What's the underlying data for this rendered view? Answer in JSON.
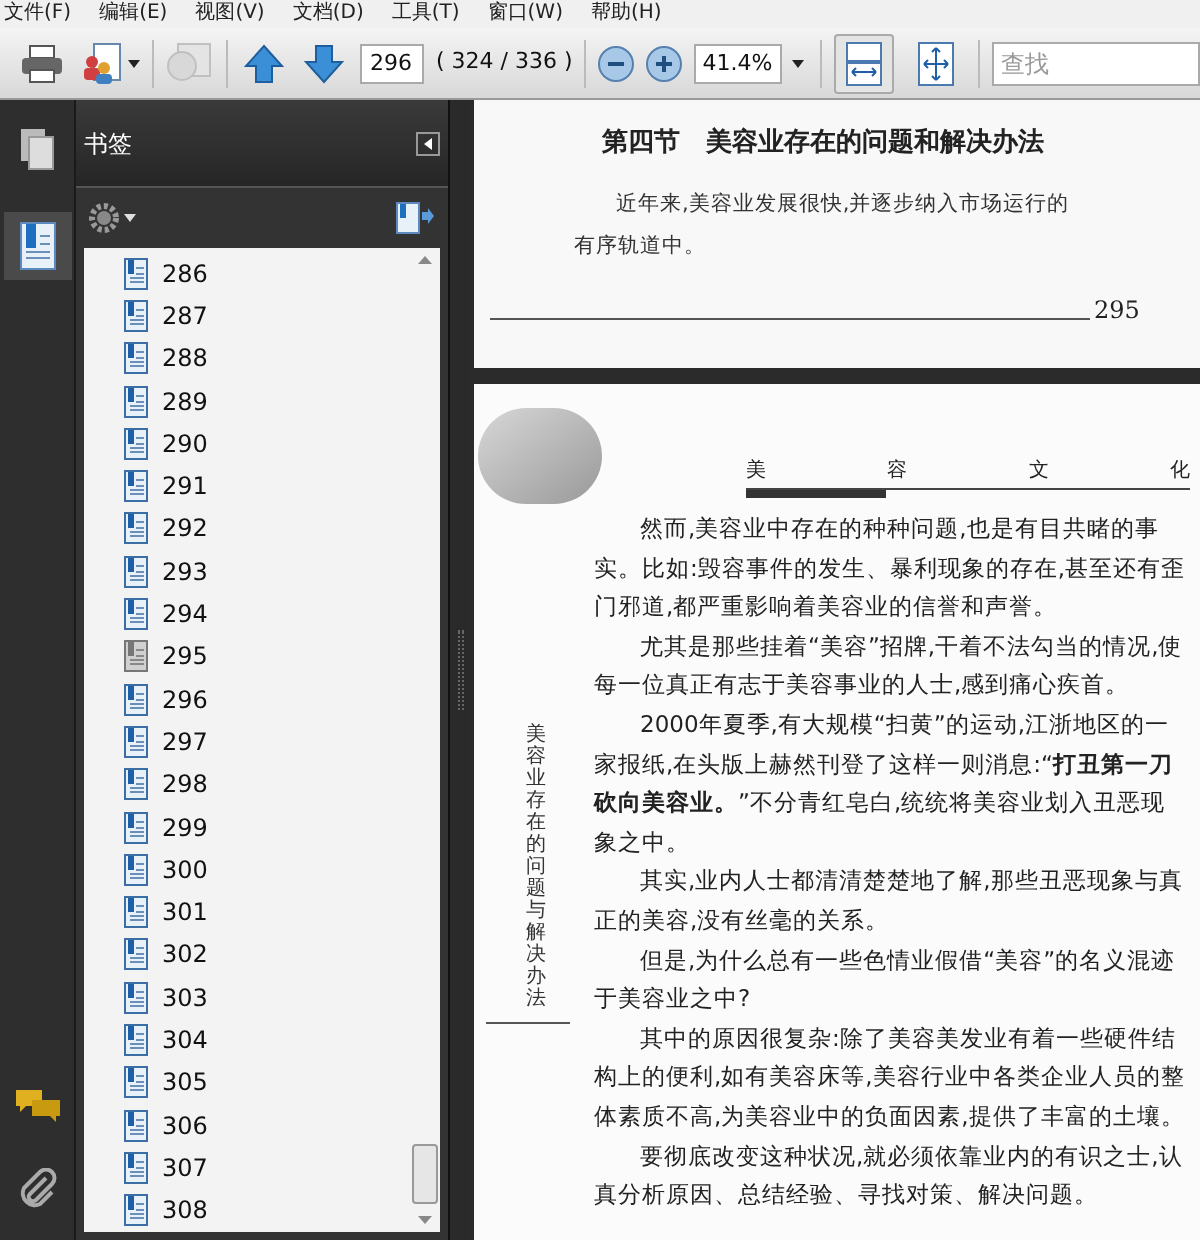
{
  "menu_bar": [
    "文件(F)",
    "编辑(E)",
    "视图(V)",
    "文档(D)",
    "工具(T)",
    "窗口(W)",
    "帮助(H)"
  ],
  "toolbar": {
    "page_input": "296",
    "page_count": "( 324 / 336 )",
    "zoom_input": "41.4%",
    "fit_width_selected": true,
    "fit_page_selected": false,
    "search": {
      "placeholder": "查找"
    }
  },
  "left_rail": [
    {
      "kind": "pages",
      "selected": false
    },
    {
      "kind": "bookmarks",
      "selected": true
    },
    {
      "kind": "comments",
      "selected": false
    },
    {
      "kind": "attachments",
      "selected": false
    }
  ],
  "bookmarks_panel": {
    "title": "书签",
    "items": [
      {
        "label": "286",
        "dimmed": false
      },
      {
        "label": "287",
        "dimmed": false
      },
      {
        "label": "288",
        "dimmed": false
      },
      {
        "label": "289",
        "dimmed": false
      },
      {
        "label": "290",
        "dimmed": false
      },
      {
        "label": "291",
        "dimmed": false
      },
      {
        "label": "292",
        "dimmed": false
      },
      {
        "label": "293",
        "dimmed": false
      },
      {
        "label": "294",
        "dimmed": false
      },
      {
        "label": "295",
        "dimmed": true
      },
      {
        "label": "296",
        "dimmed": false
      },
      {
        "label": "297",
        "dimmed": false
      },
      {
        "label": "298",
        "dimmed": false
      },
      {
        "label": "299",
        "dimmed": false
      },
      {
        "label": "300",
        "dimmed": false
      },
      {
        "label": "301",
        "dimmed": false
      },
      {
        "label": "302",
        "dimmed": false
      },
      {
        "label": "303",
        "dimmed": false
      },
      {
        "label": "304",
        "dimmed": false
      },
      {
        "label": "305",
        "dimmed": false
      },
      {
        "label": "306",
        "dimmed": false
      },
      {
        "label": "307",
        "dimmed": false
      },
      {
        "label": "308",
        "dimmed": false
      }
    ]
  },
  "page_top": {
    "title": "第四节　美容业存在的问题和解决办法",
    "paragraph": "近年来,美容业发展很快,并逐步纳入市场运行的有序轨道中。",
    "page_number": "295"
  },
  "page_main": {
    "header_chars": [
      "美",
      "容",
      "文",
      "化"
    ],
    "side_text": "美容业存在的问题与解决办法",
    "paragraphs": [
      "然而,美容业中存在的种种问题,也是有目共睹的事实。比如:毁容事件的发生、暴利现象的存在,甚至还有歪门邪道,都严重影响着美容业的信誉和声誉。",
      "尤其是那些挂着“美容”招牌,干着不法勾当的情况,使每一位真正有志于美容事业的人士,感到痛心疾首。",
      "2000年夏季,有大规模“扫黄”的运动,江浙地区的一家报纸,在头版上赫然刊登了这样一则消息:“**打丑第一刀砍向美容业。**”不分青红皂白,统统将美容业划入丑恶现象之中。",
      "其实,业内人士都清清楚楚地了解,那些丑恶现象与真正的美容,没有丝毫的关系。",
      "但是,为什么总有一些色情业假借“美容”的名义混迹于美容业之中?",
      "其中的原因很复杂:除了美容美发业有着一些硬件结构上的便利,如有美容床等,美容行业中各类企业人员的整体素质不高,为美容业中的负面因素,提供了丰富的土壤。",
      "要彻底改变这种状况,就必须依靠业内的有识之士,认真分析原因、总结经验、寻找对策、解决问题。"
    ]
  }
}
